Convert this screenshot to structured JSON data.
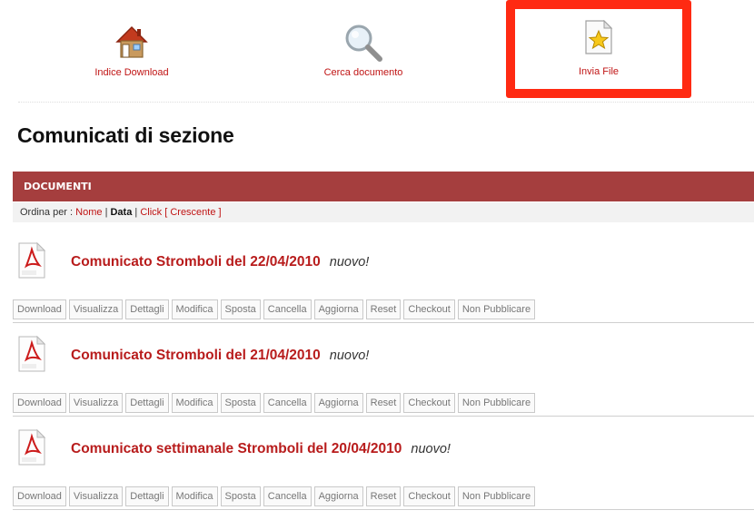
{
  "toolbar": {
    "index_label": "Indice Download",
    "index_icon": "home-icon",
    "search_label": "Cerca documento",
    "search_icon": "magnifier-icon",
    "send_label": "Invia File",
    "send_icon": "star-file-icon"
  },
  "page_title": "Comunicati di sezione",
  "section_header": "DOCUMENTI",
  "sort": {
    "prefix": "Ordina per :",
    "name": "Nome",
    "sep1": "|",
    "date": "Data",
    "sep2": "|",
    "click": "Click",
    "order": "[ Crescente ]"
  },
  "documents": [
    {
      "title": "Comunicato Stromboli del 22/04/2010",
      "badge": "nuovo!",
      "icon": "pdf-icon"
    },
    {
      "title": "Comunicato Stromboli del 21/04/2010",
      "badge": "nuovo!",
      "icon": "pdf-icon"
    },
    {
      "title": "Comunicato settimanale Stromboli del 20/04/2010",
      "badge": "nuovo!",
      "icon": "pdf-icon"
    }
  ],
  "actions": [
    "Download",
    "Visualizza",
    "Dettagli",
    "Modifica",
    "Sposta",
    "Cancella",
    "Aggiorna",
    "Reset",
    "Checkout",
    "Non Pubblicare"
  ],
  "colors": {
    "accent": "#c01414",
    "header_bg": "#a53e3e",
    "highlight_border": "#ff2a12"
  }
}
